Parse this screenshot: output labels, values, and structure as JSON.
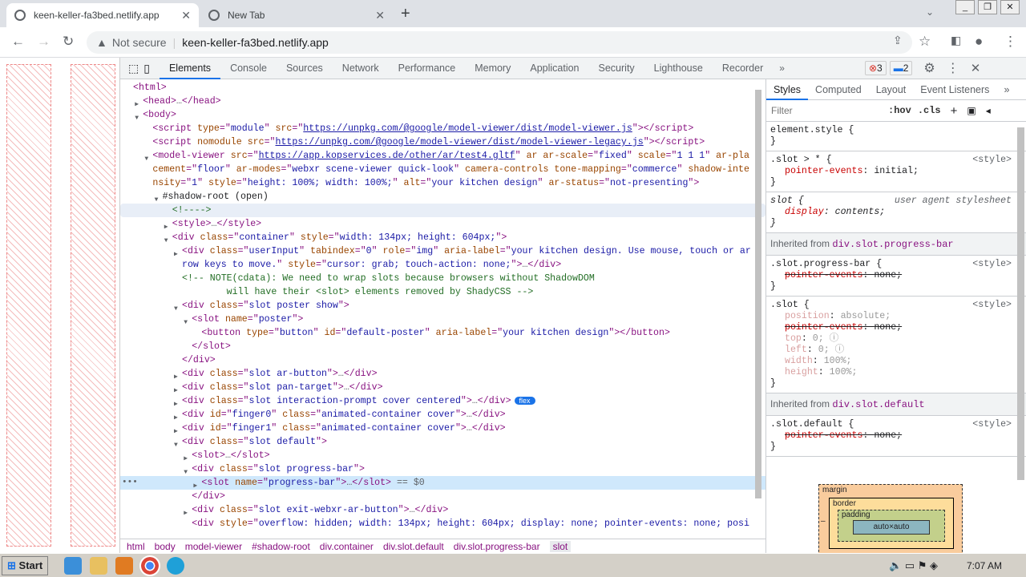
{
  "browser": {
    "tabs": [
      {
        "title": "keen-keller-fa3bed.netlify.app",
        "active": true
      },
      {
        "title": "New Tab",
        "active": false
      }
    ],
    "address": {
      "security": "Not secure",
      "url": "keen-keller-fa3bed.netlify.app"
    }
  },
  "devtools": {
    "tabs": [
      "Elements",
      "Console",
      "Sources",
      "Network",
      "Performance",
      "Memory",
      "Application",
      "Security",
      "Lighthouse",
      "Recorder"
    ],
    "active_tab": "Elements",
    "errors": "3",
    "messages": "2",
    "dom_lines": [
      {
        "lvl": 0,
        "a": "",
        "s": [
          [
            "tg",
            "<html>"
          ]
        ]
      },
      {
        "lvl": 1,
        "a": "r",
        "s": [
          [
            "tg",
            "<head>"
          ],
          [
            "dm",
            "…"
          ],
          [
            "tg",
            "</head>"
          ]
        ]
      },
      {
        "lvl": 1,
        "a": "d",
        "s": [
          [
            "tg",
            "<body>"
          ]
        ]
      },
      {
        "lvl": 2,
        "a": "",
        "s": [
          [
            "tg",
            "<script "
          ],
          [
            "an",
            "type"
          ],
          [
            "tg",
            "=\""
          ],
          [
            "av",
            "module"
          ],
          [
            "tg",
            "\" "
          ],
          [
            "an",
            "src"
          ],
          [
            "tg",
            "=\""
          ],
          [
            "lk",
            "https://unpkg.com/@google/model-viewer/dist/model-viewer.js"
          ],
          [
            "tg",
            "\"></script>"
          ]
        ]
      },
      {
        "lvl": 2,
        "a": "",
        "s": [
          [
            "tg",
            "<script "
          ],
          [
            "an",
            "nomodule"
          ],
          [
            "tg",
            " "
          ],
          [
            "an",
            "src"
          ],
          [
            "tg",
            "=\""
          ],
          [
            "lk",
            "https://unpkg.com/@google/model-viewer/dist/model-viewer-legacy.js"
          ],
          [
            "tg",
            "\"></script>"
          ]
        ]
      },
      {
        "lvl": 2,
        "a": "d",
        "s": [
          [
            "tg",
            "<model-viewer "
          ],
          [
            "an",
            "src"
          ],
          [
            "tg",
            "=\""
          ],
          [
            "lk",
            "https://app.kopservices.de/other/ar/test4.gltf"
          ],
          [
            "tg",
            "\" "
          ],
          [
            "an",
            "ar ar-scale"
          ],
          [
            "tg",
            "=\""
          ],
          [
            "av",
            "fixed"
          ],
          [
            "tg",
            "\" "
          ],
          [
            "an",
            "scale"
          ],
          [
            "tg",
            "=\""
          ],
          [
            "av",
            "1 1 1"
          ],
          [
            "tg",
            "\" "
          ],
          [
            "an",
            "ar-placement"
          ],
          [
            "tg",
            "=\""
          ],
          [
            "av",
            "floor"
          ],
          [
            "tg",
            "\" "
          ],
          [
            "an",
            "ar-modes"
          ],
          [
            "tg",
            "=\""
          ],
          [
            "av",
            "webxr scene-viewer quick-look"
          ],
          [
            "tg",
            "\" "
          ],
          [
            "an",
            "camera-controls tone-mapping"
          ],
          [
            "tg",
            "=\""
          ],
          [
            "av",
            "commerce"
          ],
          [
            "tg",
            "\" "
          ],
          [
            "an",
            "shadow-intensity"
          ],
          [
            "tg",
            "=\""
          ],
          [
            "av",
            "1"
          ],
          [
            "tg",
            "\" "
          ],
          [
            "an",
            "style"
          ],
          [
            "tg",
            "=\""
          ],
          [
            "av",
            "height: 100%; width: 100%;"
          ],
          [
            "tg",
            "\" "
          ],
          [
            "an",
            "alt"
          ],
          [
            "tg",
            "=\""
          ],
          [
            "av",
            "your kitchen design"
          ],
          [
            "tg",
            "\" "
          ],
          [
            "an",
            "ar-status"
          ],
          [
            "tg",
            "=\""
          ],
          [
            "av",
            "not-presenting"
          ],
          [
            "tg",
            "\">"
          ]
        ]
      },
      {
        "lvl": 3,
        "a": "d",
        "s": [
          [
            "tx",
            "#shadow-root (open)"
          ]
        ]
      },
      {
        "lvl": 4,
        "a": "",
        "hov": true,
        "s": [
          [
            "cm",
            "<!---->"
          ]
        ]
      },
      {
        "lvl": 4,
        "a": "r",
        "s": [
          [
            "tg",
            "<style>"
          ],
          [
            "dm",
            "…"
          ],
          [
            "tg",
            "</style>"
          ]
        ]
      },
      {
        "lvl": 4,
        "a": "d",
        "s": [
          [
            "tg",
            "<div "
          ],
          [
            "an",
            "class"
          ],
          [
            "tg",
            "=\""
          ],
          [
            "av",
            "container"
          ],
          [
            "tg",
            "\" "
          ],
          [
            "an",
            "style"
          ],
          [
            "tg",
            "=\""
          ],
          [
            "av",
            "width: 134px; height: 604px;"
          ],
          [
            "tg",
            "\">"
          ]
        ]
      },
      {
        "lvl": 5,
        "a": "r",
        "s": [
          [
            "tg",
            "<div "
          ],
          [
            "an",
            "class"
          ],
          [
            "tg",
            "=\""
          ],
          [
            "av",
            "userInput"
          ],
          [
            "tg",
            "\" "
          ],
          [
            "an",
            "tabindex"
          ],
          [
            "tg",
            "=\""
          ],
          [
            "av",
            "0"
          ],
          [
            "tg",
            "\" "
          ],
          [
            "an",
            "role"
          ],
          [
            "tg",
            "=\""
          ],
          [
            "av",
            "img"
          ],
          [
            "tg",
            "\" "
          ],
          [
            "an",
            "aria-label"
          ],
          [
            "tg",
            "=\""
          ],
          [
            "av",
            "your kitchen design. Use mouse, touch or arrow keys to move."
          ],
          [
            "tg",
            "\" "
          ],
          [
            "an",
            "style"
          ],
          [
            "tg",
            "=\""
          ],
          [
            "av",
            "cursor: grab; touch-action: none;"
          ],
          [
            "tg",
            "\">"
          ],
          [
            "dm",
            "…"
          ],
          [
            "tg",
            "</div>"
          ]
        ]
      },
      {
        "lvl": 5,
        "a": "",
        "s": [
          [
            "cm",
            "<!-- NOTE(cdata): We need to wrap slots because browsers without ShadowDOM\n        will have their <slot> elements removed by ShadyCSS -->"
          ]
        ]
      },
      {
        "lvl": 5,
        "a": "d",
        "s": [
          [
            "tg",
            "<div "
          ],
          [
            "an",
            "class"
          ],
          [
            "tg",
            "=\""
          ],
          [
            "av",
            "slot poster show"
          ],
          [
            "tg",
            "\">"
          ]
        ]
      },
      {
        "lvl": 6,
        "a": "d",
        "s": [
          [
            "tg",
            "<slot "
          ],
          [
            "an",
            "name"
          ],
          [
            "tg",
            "=\""
          ],
          [
            "av",
            "poster"
          ],
          [
            "tg",
            "\">"
          ]
        ]
      },
      {
        "lvl": 7,
        "a": "",
        "s": [
          [
            "tg",
            "<button "
          ],
          [
            "an",
            "type"
          ],
          [
            "tg",
            "=\""
          ],
          [
            "av",
            "button"
          ],
          [
            "tg",
            "\" "
          ],
          [
            "an",
            "id"
          ],
          [
            "tg",
            "=\""
          ],
          [
            "av",
            "default-poster"
          ],
          [
            "tg",
            "\" "
          ],
          [
            "an",
            "aria-label"
          ],
          [
            "tg",
            "=\""
          ],
          [
            "av",
            "your kitchen design"
          ],
          [
            "tg",
            "\"></button>"
          ]
        ]
      },
      {
        "lvl": 6,
        "a": "",
        "s": [
          [
            "tg",
            "</slot>"
          ]
        ]
      },
      {
        "lvl": 5,
        "a": "",
        "s": [
          [
            "tg",
            "</div>"
          ]
        ]
      },
      {
        "lvl": 5,
        "a": "r",
        "s": [
          [
            "tg",
            "<div "
          ],
          [
            "an",
            "class"
          ],
          [
            "tg",
            "=\""
          ],
          [
            "av",
            "slot ar-button"
          ],
          [
            "tg",
            "\">"
          ],
          [
            "dm",
            "…"
          ],
          [
            "tg",
            "</div>"
          ]
        ]
      },
      {
        "lvl": 5,
        "a": "r",
        "s": [
          [
            "tg",
            "<div "
          ],
          [
            "an",
            "class"
          ],
          [
            "tg",
            "=\""
          ],
          [
            "av",
            "slot pan-target"
          ],
          [
            "tg",
            "\">"
          ],
          [
            "dm",
            "…"
          ],
          [
            "tg",
            "</div>"
          ]
        ]
      },
      {
        "lvl": 5,
        "a": "r",
        "flex": "flex",
        "s": [
          [
            "tg",
            "<div "
          ],
          [
            "an",
            "class"
          ],
          [
            "tg",
            "=\""
          ],
          [
            "av",
            "slot interaction-prompt cover centered"
          ],
          [
            "tg",
            "\">"
          ],
          [
            "dm",
            "…"
          ],
          [
            "tg",
            "</div>"
          ]
        ]
      },
      {
        "lvl": 5,
        "a": "r",
        "s": [
          [
            "tg",
            "<div "
          ],
          [
            "an",
            "id"
          ],
          [
            "tg",
            "=\""
          ],
          [
            "av",
            "finger0"
          ],
          [
            "tg",
            "\" "
          ],
          [
            "an",
            "class"
          ],
          [
            "tg",
            "=\""
          ],
          [
            "av",
            "animated-container cover"
          ],
          [
            "tg",
            "\">"
          ],
          [
            "dm",
            "…"
          ],
          [
            "tg",
            "</div>"
          ]
        ]
      },
      {
        "lvl": 5,
        "a": "r",
        "s": [
          [
            "tg",
            "<div "
          ],
          [
            "an",
            "id"
          ],
          [
            "tg",
            "=\""
          ],
          [
            "av",
            "finger1"
          ],
          [
            "tg",
            "\" "
          ],
          [
            "an",
            "class"
          ],
          [
            "tg",
            "=\""
          ],
          [
            "av",
            "animated-container cover"
          ],
          [
            "tg",
            "\">"
          ],
          [
            "dm",
            "…"
          ],
          [
            "tg",
            "</div>"
          ]
        ]
      },
      {
        "lvl": 5,
        "a": "d",
        "s": [
          [
            "tg",
            "<div "
          ],
          [
            "an",
            "class"
          ],
          [
            "tg",
            "=\""
          ],
          [
            "av",
            "slot default"
          ],
          [
            "tg",
            "\">"
          ]
        ]
      },
      {
        "lvl": 6,
        "a": "r",
        "s": [
          [
            "tg",
            "<slot>"
          ],
          [
            "dm",
            "…"
          ],
          [
            "tg",
            "</slot>"
          ]
        ]
      },
      {
        "lvl": 6,
        "a": "d",
        "s": [
          [
            "tg",
            "<div "
          ],
          [
            "an",
            "class"
          ],
          [
            "tg",
            "=\""
          ],
          [
            "av",
            "slot progress-bar"
          ],
          [
            "tg",
            "\">"
          ]
        ]
      },
      {
        "lvl": 7,
        "a": "r",
        "sel": true,
        "s": [
          [
            "tg",
            "<slot "
          ],
          [
            "an",
            "name"
          ],
          [
            "tg",
            "=\""
          ],
          [
            "av",
            "progress-bar"
          ],
          [
            "tg",
            "\">"
          ],
          [
            "dm",
            "…"
          ],
          [
            "tg",
            "</slot>"
          ],
          [
            "dm",
            " == $0"
          ]
        ]
      },
      {
        "lvl": 6,
        "a": "",
        "s": [
          [
            "tg",
            "</div>"
          ]
        ]
      },
      {
        "lvl": 6,
        "a": "r",
        "s": [
          [
            "tg",
            "<div "
          ],
          [
            "an",
            "class"
          ],
          [
            "tg",
            "=\""
          ],
          [
            "av",
            "slot exit-webxr-ar-button"
          ],
          [
            "tg",
            "\">"
          ],
          [
            "dm",
            "…"
          ],
          [
            "tg",
            "</div>"
          ]
        ]
      },
      {
        "lvl": 6,
        "a": "",
        "nowrap": true,
        "s": [
          [
            "tg",
            "<div "
          ],
          [
            "an",
            "style"
          ],
          [
            "tg",
            "=\""
          ],
          [
            "av",
            "overflow: hidden; width: 134px; height: 604px; display: none; pointer-events: none; posi"
          ]
        ]
      }
    ],
    "breadcrumbs": [
      "html",
      "body",
      "model-viewer",
      "#shadow-root",
      "div.container",
      "div.slot.default",
      "div.slot.progress-bar",
      "slot"
    ],
    "styles": {
      "tabs": [
        "Styles",
        "Computed",
        "Layout",
        "Event Listeners"
      ],
      "filter_placeholder": "Filter",
      "hov": ":hov",
      "cls": ".cls",
      "element_style": "element.style {",
      "rule1": {
        "selector": ".slot > * {",
        "source": "<style>",
        "prop": "pointer-events",
        "value": "initial;"
      },
      "rule2": {
        "selector": "slot {",
        "source": "user agent stylesheet",
        "prop": "display",
        "value": "contents;"
      },
      "inherited1": {
        "label": "Inherited from ",
        "selector": "div.slot.progress-bar"
      },
      "rule3": {
        "selector": ".slot.progress-bar {",
        "source": "<style>",
        "prop": "pointer-events",
        "value": "none;"
      },
      "rule4": {
        "selector": ".slot {",
        "source": "<style>",
        "props": [
          [
            "position",
            "absolute;"
          ],
          [
            "pointer-events",
            "none;"
          ],
          [
            "top",
            "0;"
          ],
          [
            "left",
            "0;"
          ],
          [
            "width",
            "100%;"
          ],
          [
            "height",
            "100%;"
          ]
        ]
      },
      "inherited2": {
        "label": "Inherited from ",
        "selector": "div.slot.default"
      },
      "rule5": {
        "selector": ".slot.default {",
        "source": "<style>",
        "prop": "pointer-events",
        "value": "none;"
      },
      "boxmodel": {
        "margin": "margin",
        "border": "border",
        "padding": "padding",
        "content": "auto×auto",
        "dash": "–"
      }
    }
  },
  "taskbar": {
    "start": "Start",
    "time": "7:07 AM"
  }
}
